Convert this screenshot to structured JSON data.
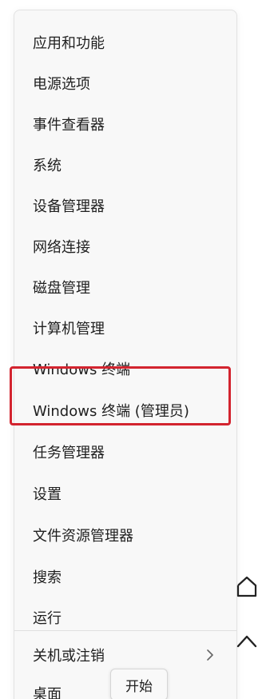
{
  "menu": {
    "items": [
      {
        "label": "应用和功能"
      },
      {
        "label": "电源选项"
      },
      {
        "label": "事件查看器"
      },
      {
        "label": "系统"
      },
      {
        "label": "设备管理器"
      },
      {
        "label": "网络连接"
      },
      {
        "label": "磁盘管理"
      },
      {
        "label": "计算机管理"
      },
      {
        "label": "Windows 终端"
      },
      {
        "label": "Windows 终端 (管理员)"
      },
      {
        "label": "任务管理器"
      },
      {
        "label": "设置"
      },
      {
        "label": "文件资源管理器"
      },
      {
        "label": "搜索"
      },
      {
        "label": "运行"
      },
      {
        "label": "关机或注销"
      },
      {
        "label": "桌面"
      }
    ]
  },
  "tooltip": {
    "label": "开始"
  },
  "icons": {
    "submenu_chevron": "chevron-right-icon",
    "side_home": "home-icon",
    "side_up": "chevron-up-icon"
  },
  "colors": {
    "highlight": "#d3242f",
    "menu_bg": "#f8f8f8",
    "text": "#1f1f1f"
  }
}
